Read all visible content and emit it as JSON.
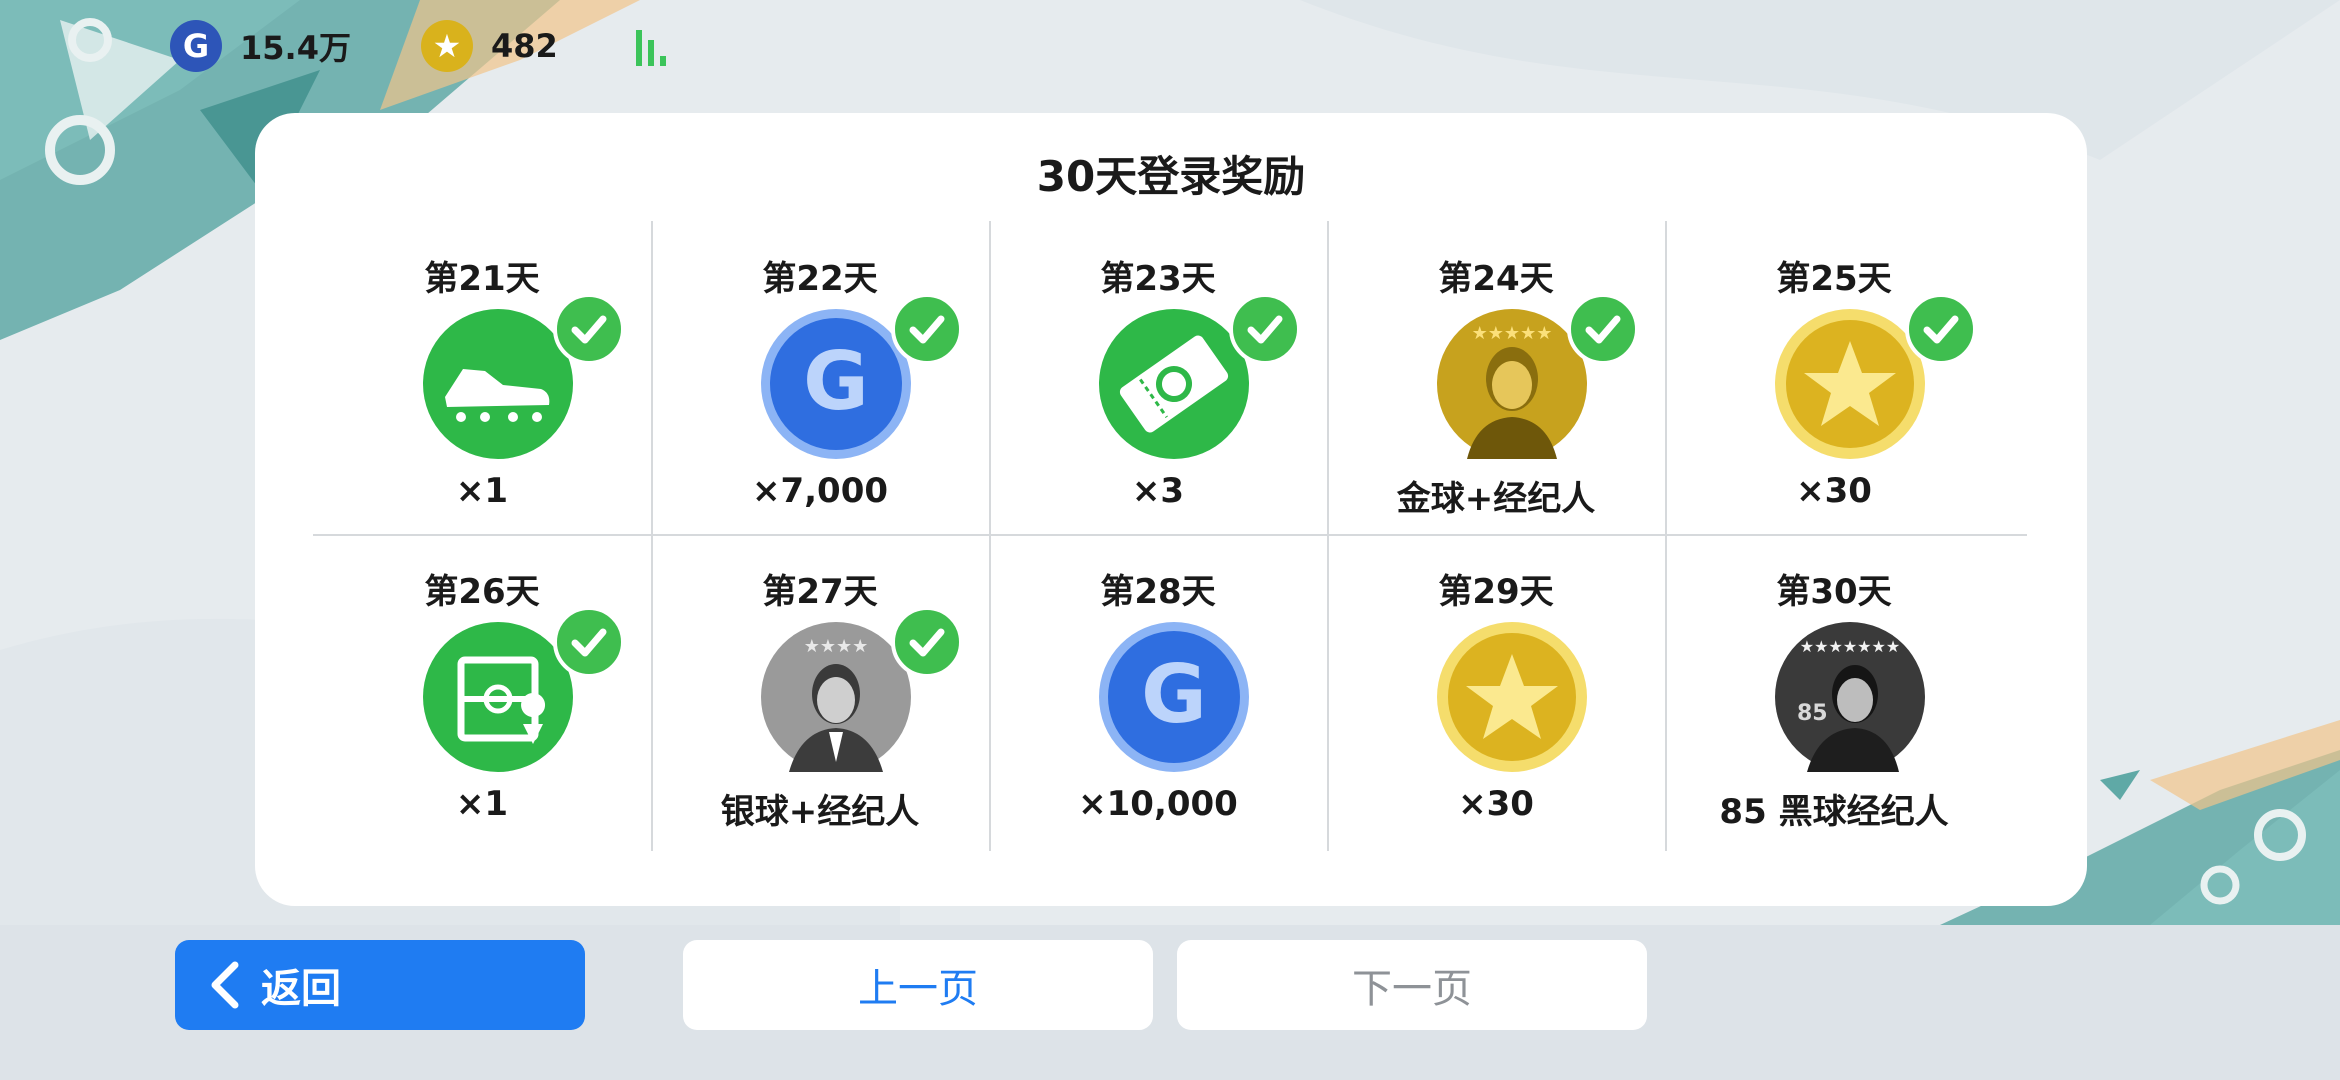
{
  "header": {
    "currencies": [
      {
        "icon": "g-coin-icon",
        "value": "15.4万"
      },
      {
        "icon": "star-coin-icon",
        "value": "482"
      }
    ],
    "signal_icon": "signal-bars-icon"
  },
  "panel": {
    "title": "30天登录奖励",
    "rewards": [
      {
        "day": "第21天",
        "amount": "×1",
        "icon": "boots-icon",
        "claimed": true
      },
      {
        "day": "第22天",
        "amount": "×7,000",
        "icon": "g-coin-icon",
        "claimed": true
      },
      {
        "day": "第23天",
        "amount": "×3",
        "icon": "ticket-icon",
        "claimed": true
      },
      {
        "day": "第24天",
        "amount": "金球+经纪人",
        "icon": "gold-player-icon",
        "claimed": true
      },
      {
        "day": "第25天",
        "amount": "×30",
        "icon": "star-coin-icon",
        "claimed": true
      },
      {
        "day": "第26天",
        "amount": "×1",
        "icon": "tactics-board-icon",
        "claimed": true
      },
      {
        "day": "第27天",
        "amount": "银球+经纪人",
        "icon": "silver-player-icon",
        "claimed": true
      },
      {
        "day": "第28天",
        "amount": "×10,000",
        "icon": "g-coin-icon",
        "claimed": false
      },
      {
        "day": "第29天",
        "amount": "×30",
        "icon": "star-coin-icon",
        "claimed": false
      },
      {
        "day": "第30天",
        "amount": "85 黑球经纪人",
        "icon": "black-player-icon",
        "claimed": false
      }
    ]
  },
  "footer": {
    "back_label": "返回",
    "prev_label": "上一页",
    "next_label": "下一页"
  },
  "colors": {
    "accent_blue": "#1f7cf2",
    "check_green": "#3fbe4f",
    "disabled_text": "#8e9297"
  }
}
